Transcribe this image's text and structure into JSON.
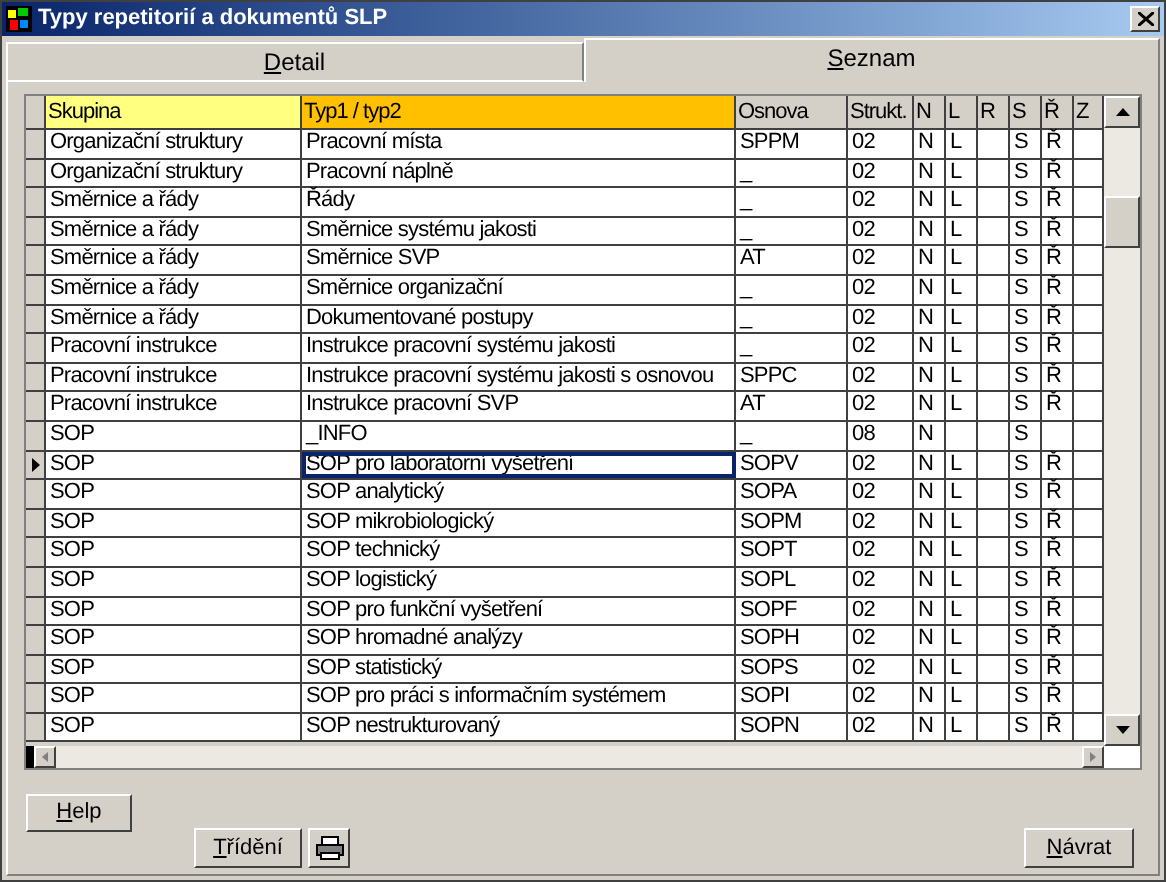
{
  "window": {
    "title": "Typy repetitorií a dokumentů SLP"
  },
  "tabs": [
    {
      "label": "Detail",
      "selected": false
    },
    {
      "label": "Seznam",
      "selected": true
    }
  ],
  "table": {
    "columns": [
      {
        "label": "Skupina",
        "color": "#ffff80"
      },
      {
        "label": "Typ1 / typ2",
        "color": "#ffc000"
      },
      {
        "label": "Osnova",
        "color": "#d4d0c8"
      },
      {
        "label": "Strukt.",
        "color": "#d4d0c8"
      },
      {
        "label": "N",
        "color": "#d4d0c8"
      },
      {
        "label": "L",
        "color": "#d4d0c8"
      },
      {
        "label": "R",
        "color": "#d4d0c8"
      },
      {
        "label": "S",
        "color": "#d4d0c8"
      },
      {
        "label": "Ř",
        "color": "#d4d0c8"
      },
      {
        "label": "Z",
        "color": "#d4d0c8"
      }
    ],
    "rows": [
      {
        "cells": [
          "Organizační struktury",
          "Pracovní místa",
          "SPPM",
          "02",
          "N",
          "L",
          null,
          "S",
          "Ř",
          null
        ],
        "selected": false
      },
      {
        "cells": [
          "Organizační struktury",
          "Pracovní náplně",
          "_",
          "02",
          "N",
          "L",
          null,
          "S",
          "Ř",
          null
        ],
        "selected": false
      },
      {
        "cells": [
          "Směrnice a řády",
          "Řády",
          "_",
          "02",
          "N",
          "L",
          null,
          "S",
          "Ř",
          null
        ],
        "selected": false
      },
      {
        "cells": [
          "Směrnice a řády",
          "Směrnice systému jakosti",
          "_",
          "02",
          "N",
          "L",
          null,
          "S",
          "Ř",
          null
        ],
        "selected": false
      },
      {
        "cells": [
          "Směrnice a řády",
          "Směrnice SVP",
          "AT",
          "02",
          "N",
          "L",
          null,
          "S",
          "Ř",
          null
        ],
        "selected": false
      },
      {
        "cells": [
          "Směrnice a řády",
          "Směrnice organizační",
          "_",
          "02",
          "N",
          "L",
          null,
          "S",
          "Ř",
          null
        ],
        "selected": false
      },
      {
        "cells": [
          "Směrnice a řády",
          "Dokumentované postupy",
          "_",
          "02",
          "N",
          "L",
          null,
          "S",
          "Ř",
          null
        ],
        "selected": false
      },
      {
        "cells": [
          "Pracovní instrukce",
          "Instrukce pracovní systému jakosti",
          "_",
          "02",
          "N",
          "L",
          null,
          "S",
          "Ř",
          null
        ],
        "selected": false
      },
      {
        "cells": [
          "Pracovní instrukce",
          "Instrukce pracovní systému jakosti s osnovou",
          "SPPC",
          "02",
          "N",
          "L",
          null,
          "S",
          "Ř",
          null
        ],
        "selected": false
      },
      {
        "cells": [
          "Pracovní instrukce",
          "Instrukce pracovní SVP",
          "AT",
          "02",
          "N",
          "L",
          null,
          "S",
          "Ř",
          null
        ],
        "selected": false
      },
      {
        "cells": [
          "SOP",
          "_INFO",
          "_",
          "08",
          "N",
          null,
          null,
          "S",
          null,
          null
        ],
        "selected": false
      },
      {
        "cells": [
          "SOP",
          "SOP pro laboratorní vyšetření",
          "SOPV",
          "02",
          "N",
          "L",
          null,
          "S",
          "Ř",
          null
        ],
        "selected": true
      },
      {
        "cells": [
          "SOP",
          "SOP analytický",
          "SOPA",
          "02",
          "N",
          "L",
          null,
          "S",
          "Ř",
          null
        ],
        "selected": false
      },
      {
        "cells": [
          "SOP",
          "SOP mikrobiologický",
          "SOPM",
          "02",
          "N",
          "L",
          null,
          "S",
          "Ř",
          null
        ],
        "selected": false
      },
      {
        "cells": [
          "SOP",
          "SOP technický",
          "SOPT",
          "02",
          "N",
          "L",
          null,
          "S",
          "Ř",
          null
        ],
        "selected": false
      },
      {
        "cells": [
          "SOP",
          "SOP logistický",
          "SOPL",
          "02",
          "N",
          "L",
          null,
          "S",
          "Ř",
          null
        ],
        "selected": false
      },
      {
        "cells": [
          "SOP",
          "SOP pro funkční vyšetření",
          "SOPF",
          "02",
          "N",
          "L",
          null,
          "S",
          "Ř",
          null
        ],
        "selected": false
      },
      {
        "cells": [
          "SOP",
          "SOP hromadné analýzy",
          "SOPH",
          "02",
          "N",
          "L",
          null,
          "S",
          "Ř",
          null
        ],
        "selected": false
      },
      {
        "cells": [
          "SOP",
          "SOP statistický",
          "SOPS",
          "02",
          "N",
          "L",
          null,
          "S",
          "Ř",
          null
        ],
        "selected": false
      },
      {
        "cells": [
          "SOP",
          "SOP pro práci s informačním systémem",
          "SOPI",
          "02",
          "N",
          "L",
          null,
          "S",
          "Ř",
          null
        ],
        "selected": false
      },
      {
        "cells": [
          "SOP",
          "SOP nestrukturovaný",
          "SOPN",
          "02",
          "N",
          "L",
          null,
          "S",
          "Ř",
          null
        ],
        "selected": false
      }
    ]
  },
  "buttons": {
    "help": "Help",
    "sort": "Třídění",
    "back": "Návrat"
  }
}
